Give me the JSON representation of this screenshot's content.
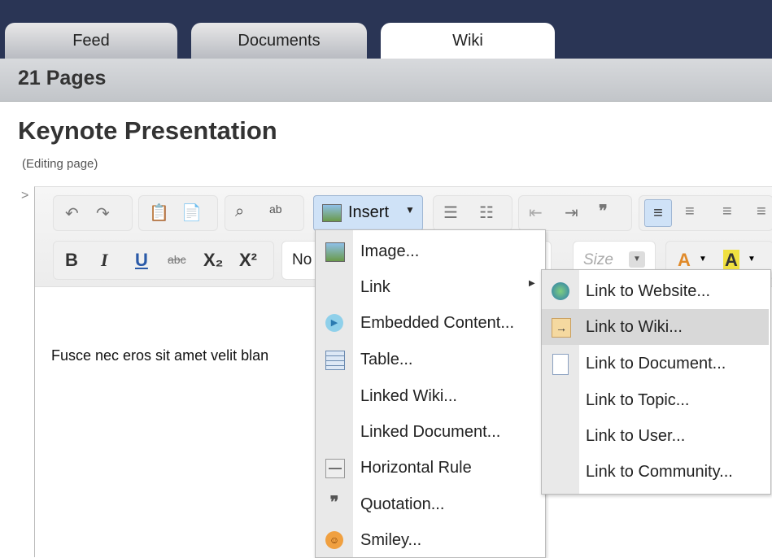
{
  "tabs": [
    {
      "label": "Feed"
    },
    {
      "label": "Documents"
    },
    {
      "label": "Wiki"
    }
  ],
  "pages_count": "21 Pages",
  "page_title": "Keynote Presentation",
  "page_status": "(Editing page)",
  "toolbar": {
    "insert_label": "Insert",
    "font_name": "No",
    "size_placeholder": "Size",
    "bold": "B",
    "italic": "I",
    "underline": "U",
    "strike": "abc",
    "subscript": "X₂",
    "superscript": "X²",
    "quote_icon": "❞"
  },
  "editor_text": "Fusce nec eros sit amet velit blan",
  "insert_menu": [
    {
      "label": "Image...",
      "icon": "image-icon"
    },
    {
      "label": "Link",
      "icon": "",
      "has_submenu": true
    },
    {
      "label": "Embedded Content...",
      "icon": "play-icon"
    },
    {
      "label": "Table...",
      "icon": "table-icon"
    },
    {
      "label": "Linked Wiki...",
      "icon": ""
    },
    {
      "label": "Linked Document...",
      "icon": ""
    },
    {
      "label": "Horizontal Rule",
      "icon": "horizontal-rule-icon"
    },
    {
      "label": "Quotation...",
      "icon": "quotation-icon"
    },
    {
      "label": "Smiley...",
      "icon": "smiley-icon"
    }
  ],
  "link_submenu": [
    {
      "label": "Link to Website...",
      "icon": "globe-icon"
    },
    {
      "label": "Link to Wiki...",
      "icon": "wiki-link-icon",
      "highlighted": true
    },
    {
      "label": "Link to Document...",
      "icon": "document-icon"
    },
    {
      "label": "Link to Topic...",
      "icon": ""
    },
    {
      "label": "Link to User...",
      "icon": ""
    },
    {
      "label": "Link to Community...",
      "icon": ""
    }
  ],
  "colors": {
    "topbar": "#2a3555",
    "insert_active": "#cfe2f7",
    "menu_highlight": "#d8d8d8"
  }
}
